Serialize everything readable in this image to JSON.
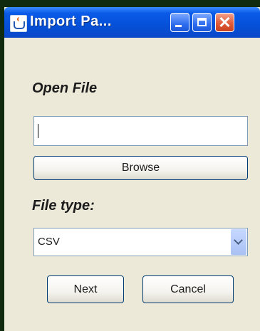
{
  "window": {
    "title": "Import Pa...",
    "app_icon": "java-cup-icon",
    "controls": [
      "minimize-icon",
      "maximize-icon",
      "close-icon"
    ],
    "close_glyph": "✕"
  },
  "open_file": {
    "heading": "Open File",
    "path_value": "",
    "browse_label": "Browse"
  },
  "file_type": {
    "heading": "File type:",
    "selected": "CSV"
  },
  "actions": {
    "next_label": "Next",
    "cancel_label": "Cancel"
  },
  "colors": {
    "titlebar": "#0550d8",
    "close_button": "#e05c3a",
    "dialog_bg": "#ece9d8"
  }
}
